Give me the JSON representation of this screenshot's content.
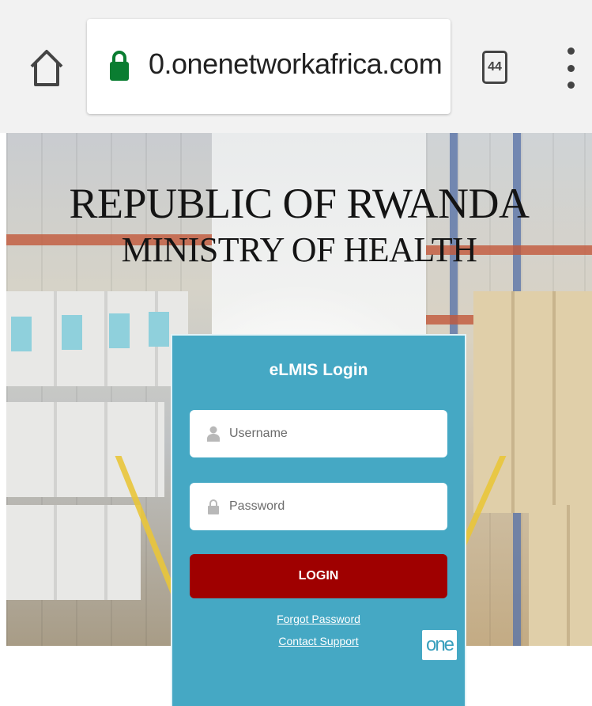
{
  "browser": {
    "url": "0.onenetworkafrica.com",
    "tab_count": "44",
    "icons": {
      "home": "home-icon",
      "lock": "lock-icon",
      "tabs": "tabs-icon",
      "menu": "more-vert-icon"
    },
    "colors": {
      "lock": "#0a7d31"
    }
  },
  "hero": {
    "title": "REPUBLIC OF RWANDA",
    "subtitle": "MINISTRY OF HEALTH"
  },
  "login": {
    "title": "eLMIS Login",
    "username_placeholder": "Username",
    "password_placeholder": "Password",
    "login_label": "LOGIN",
    "forgot_password": "Forgot Password",
    "contact_support": "Contact Support",
    "logo_text": "one",
    "colors": {
      "panel": "#45a8c4",
      "button": "#9f0000"
    }
  }
}
